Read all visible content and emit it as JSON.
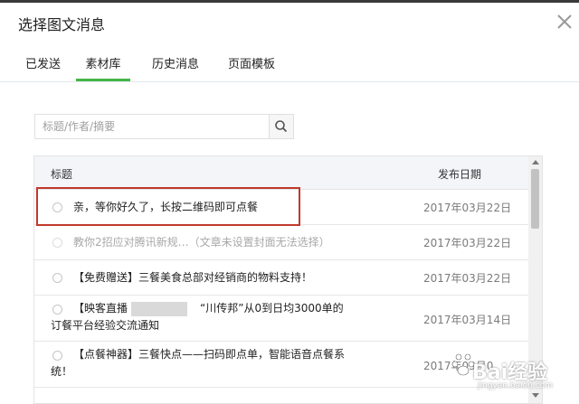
{
  "dialog": {
    "title": "选择图文消息"
  },
  "tabs": [
    {
      "label": "已发送"
    },
    {
      "label": "素材库"
    },
    {
      "label": "历史消息"
    },
    {
      "label": "页面模板"
    }
  ],
  "search": {
    "placeholder": "标题/作者/摘要",
    "value": ""
  },
  "table": {
    "headers": {
      "title": "标题",
      "date": "发布日期"
    },
    "rows": [
      {
        "title": "亲，等你好久了，长按二维码即可点餐",
        "date": "2017年03月22日"
      },
      {
        "title": "教你2招应对腾讯新规…（文章未设置封面无法选择）",
        "date": "2017年03月22日"
      },
      {
        "title": "【免费赠送】三餐美食总部对经销商的物料支持！",
        "date": "2017年03月22日"
      },
      {
        "title_a": "【映客直播",
        "title_b": "“川传邦”从0到日均3000单的",
        "title_c": "订餐平台经验交流通知",
        "date": "2017年03月14日"
      },
      {
        "title_a": "【点餐神器】三餐快点——扫码即点单，智能语音点餐系",
        "title_b": "统！",
        "date": "2017年03月0"
      }
    ]
  },
  "watermark": {
    "logo": "Bai经验",
    "url": "jingyan.baidu.com"
  },
  "colors": {
    "accent": "#44b549",
    "highlight": "#c0392b",
    "header_bg": "#f4f5f9"
  }
}
